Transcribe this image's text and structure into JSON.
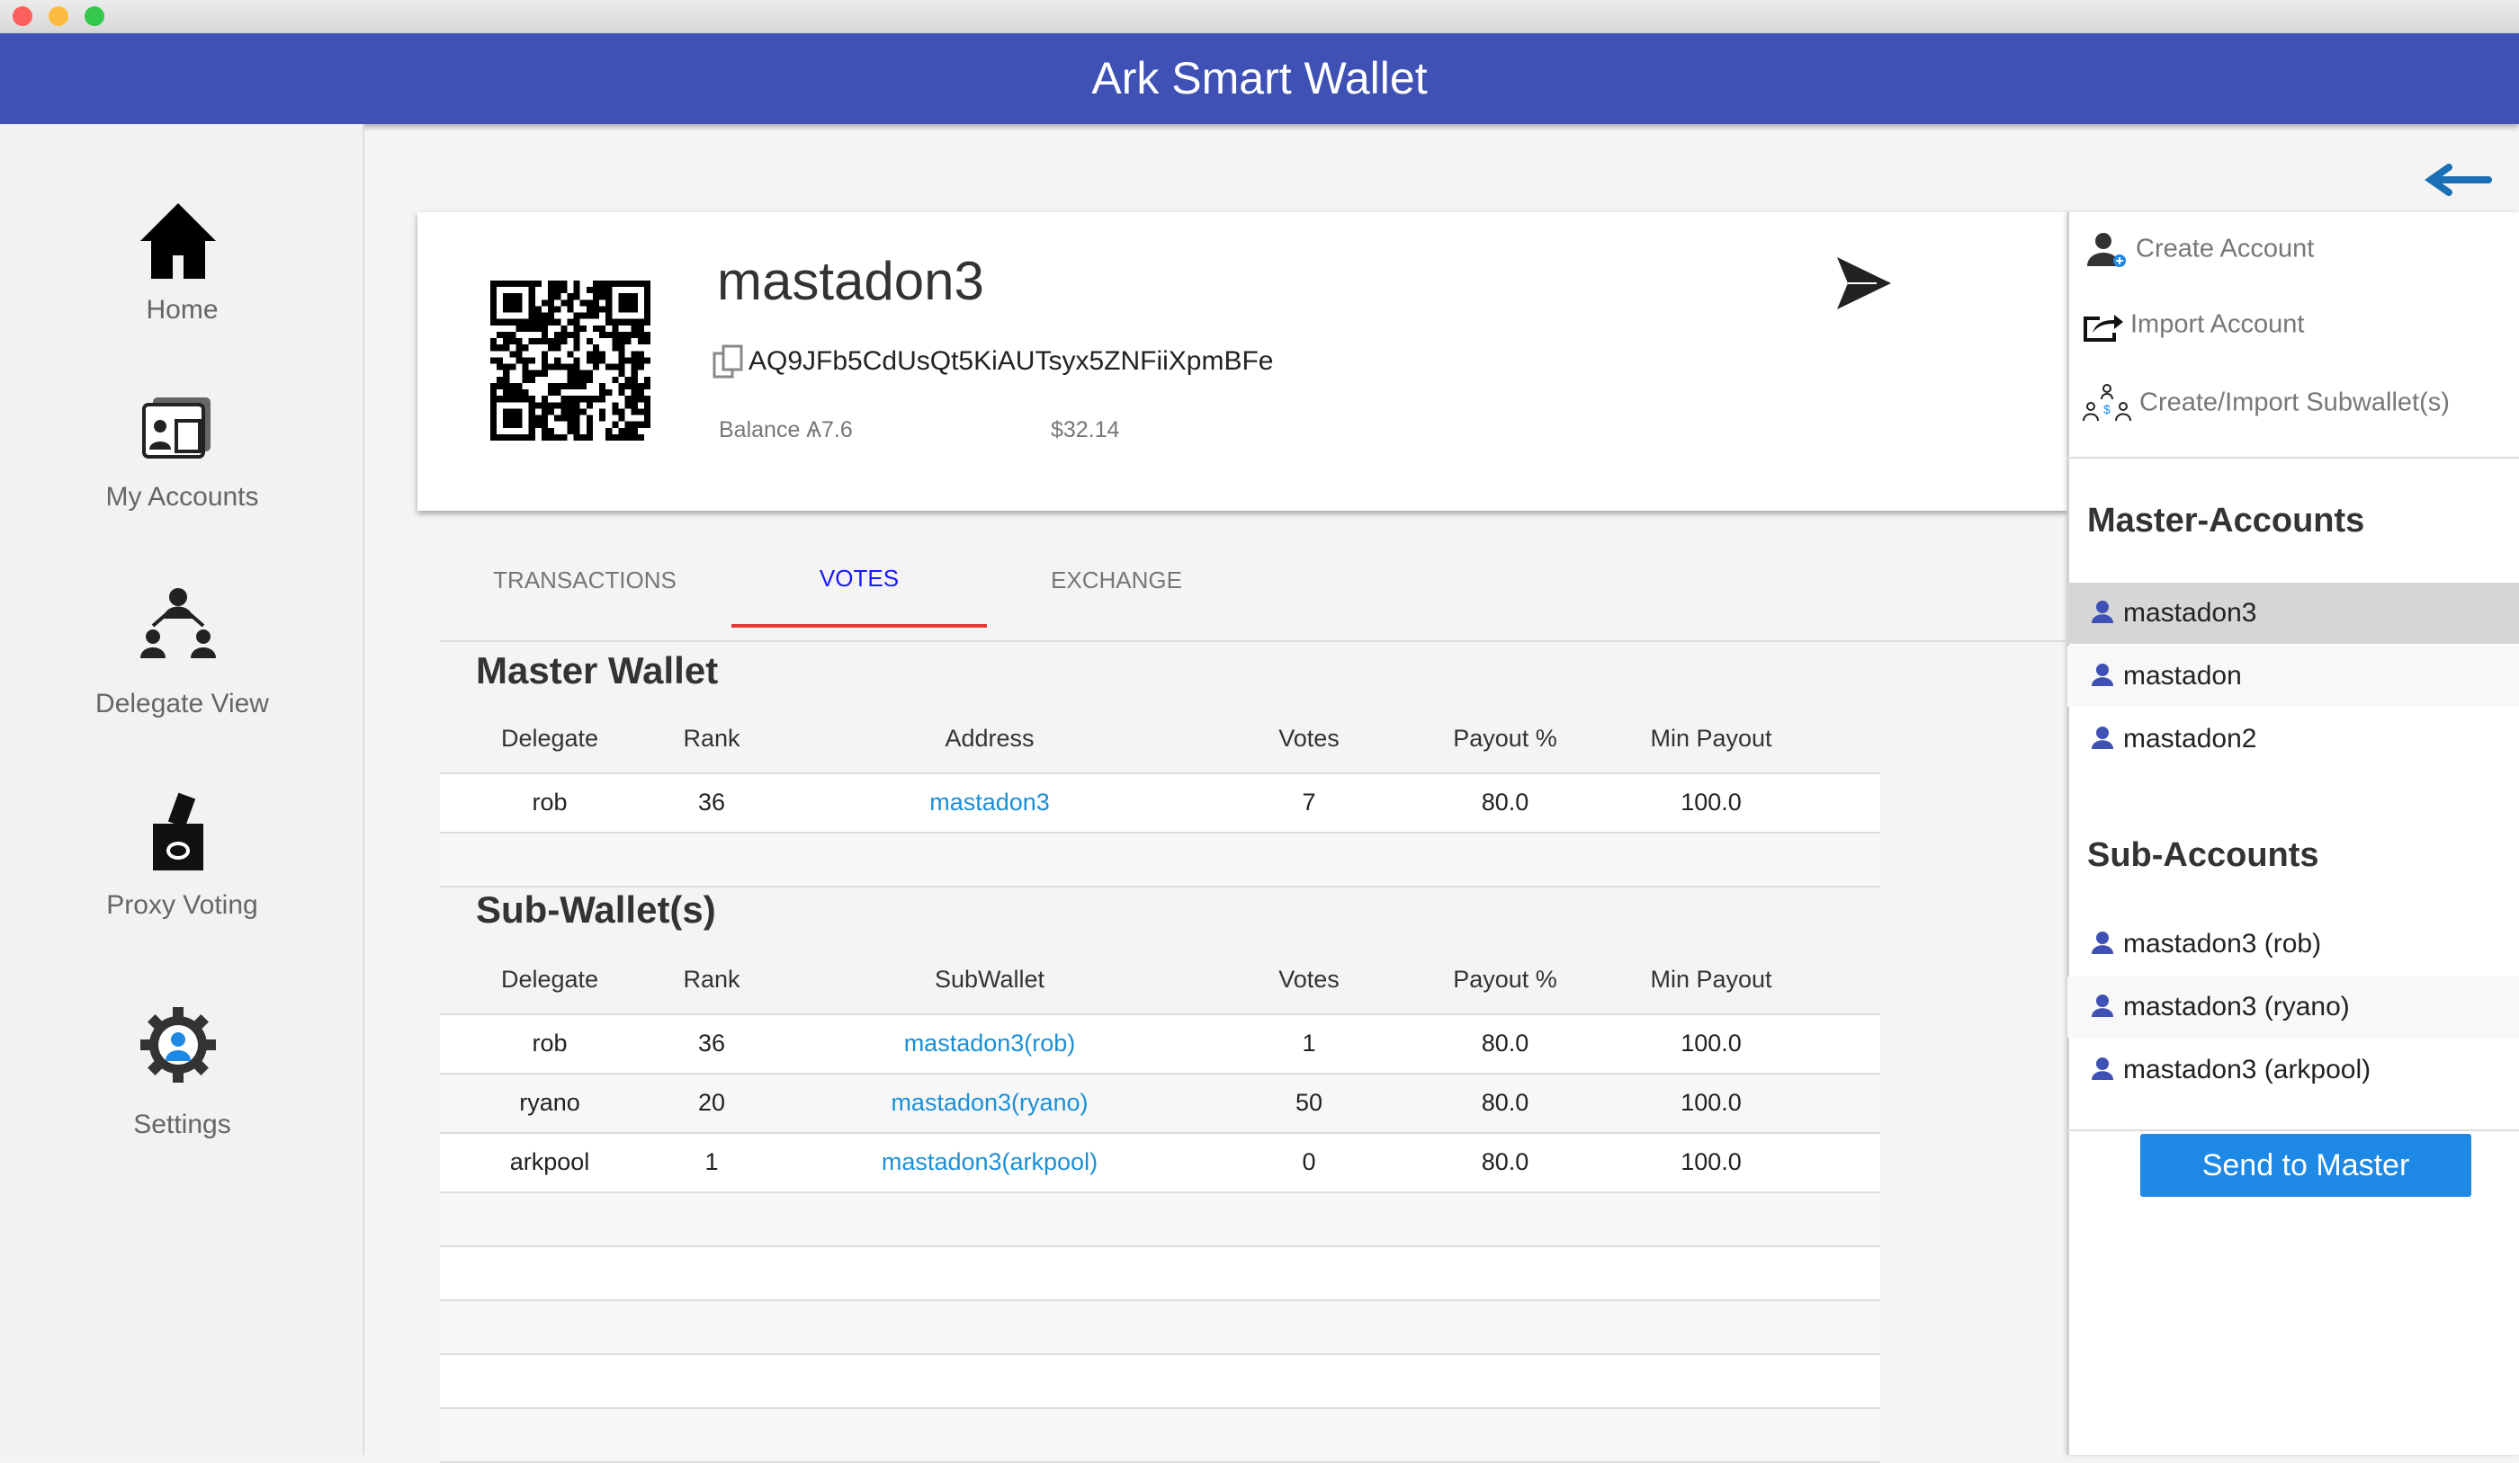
{
  "app": {
    "title": "Ark Smart Wallet"
  },
  "sidebar": {
    "items": [
      {
        "label": "Home",
        "icon": "home-icon"
      },
      {
        "label": "My Accounts",
        "icon": "accounts-icon"
      },
      {
        "label": "Delegate View",
        "icon": "delegate-icon"
      },
      {
        "label": "Proxy Voting",
        "icon": "ballot-icon"
      },
      {
        "label": "Settings",
        "icon": "gear-icon"
      }
    ]
  },
  "account": {
    "name": "mastadon3",
    "address": "AQ9JFb5CdUsQt5KiAUTsyx5ZNFiiXpmBFe",
    "balance": "Balance Ѧ7.6",
    "usd": "$32.14"
  },
  "tabs": [
    {
      "label": "TRANSACTIONS"
    },
    {
      "label": "VOTES",
      "active": true
    },
    {
      "label": "EXCHANGE"
    }
  ],
  "master_wallet": {
    "title": "Master Wallet",
    "columns": [
      "Delegate",
      "Rank",
      "Address",
      "Votes",
      "Payout %",
      "Min Payout"
    ],
    "rows": [
      [
        "rob",
        "36",
        "mastadon3",
        "7",
        "80.0",
        "100.0"
      ]
    ]
  },
  "sub_wallets": {
    "title": "Sub-Wallet(s)",
    "columns": [
      "Delegate",
      "Rank",
      "SubWallet",
      "Votes",
      "Payout %",
      "Min Payout"
    ],
    "rows": [
      [
        "rob",
        "36",
        "mastadon3(rob)",
        "1",
        "80.0",
        "100.0"
      ],
      [
        "ryano",
        "20",
        "mastadon3(ryano)",
        "50",
        "80.0",
        "100.0"
      ],
      [
        "arkpool",
        "1",
        "mastadon3(arkpool)",
        "0",
        "80.0",
        "100.0"
      ]
    ]
  },
  "right_panel": {
    "menu": [
      "Create Account",
      "Import Account",
      "Create/Import Subwallet(s)"
    ],
    "master_title": "Master-Accounts",
    "masters": [
      "mastadon3",
      "mastadon",
      "mastadon2"
    ],
    "sub_title": "Sub-Accounts",
    "subs": [
      "mastadon3 (rob)",
      "mastadon3 (ryano)",
      "mastadon3 (arkpool)"
    ],
    "send_label": "Send to Master"
  },
  "colors": {
    "header": "#3f51b5",
    "accent": "#1e88e5",
    "tab_active": "#1a1aff",
    "tab_underline": "#e53935",
    "link": "#1a8fd6",
    "user_icon": "#3f51b5"
  }
}
